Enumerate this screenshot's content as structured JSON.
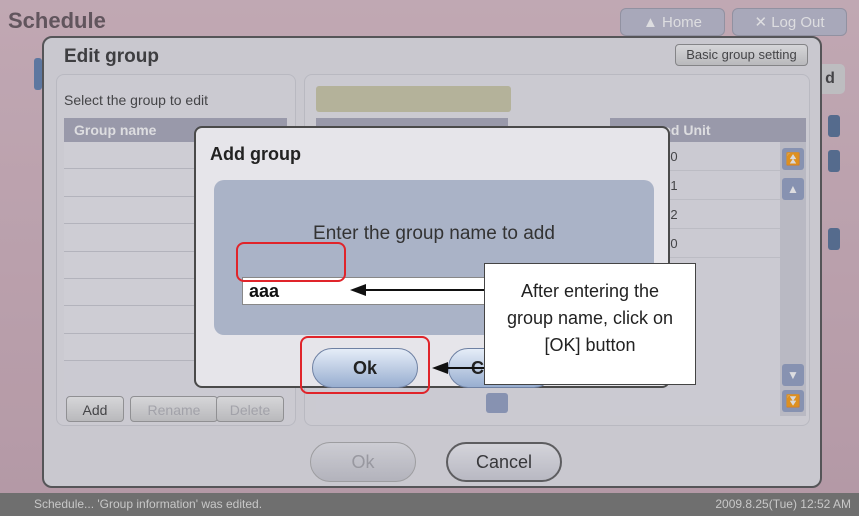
{
  "background_app": {
    "title": "Schedule",
    "home_button": "Home",
    "logout_button": "Log Out",
    "add_button_fragment": "d",
    "status_left": "Schedule... 'Group information' was edited.",
    "status_right": "2009.8.25(Tue)  12:52 AM"
  },
  "edit_group": {
    "title": "Edit group",
    "basic_setting_button": "Basic group setting",
    "select_label": "Select the group to edit",
    "list_header": "Group name",
    "add_button": "Add",
    "rename_button": "Rename",
    "delete_button": "Delete",
    "unit_header": "gned Unit",
    "unit_rows": [
      "-0",
      "-1",
      "-2",
      "-0"
    ],
    "ok_button": "Ok",
    "cancel_button": "Cancel"
  },
  "add_group": {
    "title": "Add group",
    "prompt": "Enter the group name  to add",
    "input_value": "aaa",
    "ok_button": "Ok",
    "cancel_button": "C"
  },
  "annotation": {
    "callout_line1": "After entering the",
    "callout_line2": "group name, click on",
    "callout_line3": "[OK] button",
    "highlight_color": "#e0242a"
  }
}
